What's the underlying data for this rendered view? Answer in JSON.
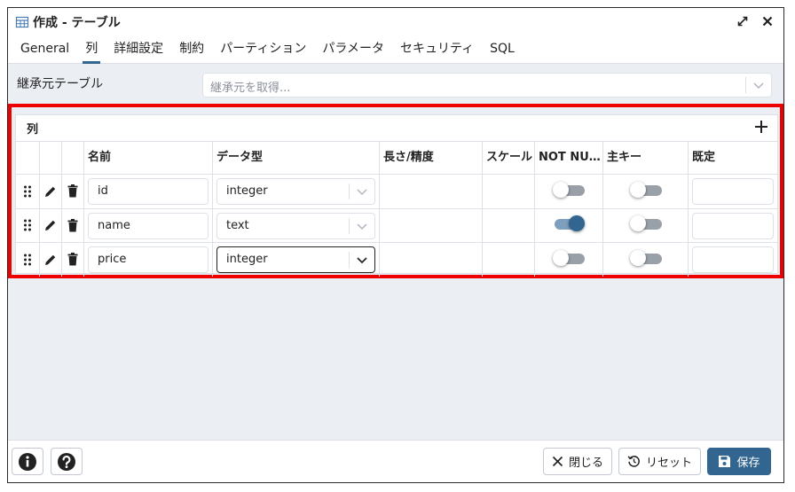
{
  "dialog": {
    "title": "作成 - テーブル",
    "icons": {
      "title": "table-icon",
      "maximize": "maximize-icon",
      "close": "close-icon"
    }
  },
  "tabs": [
    {
      "label": "General",
      "active": false
    },
    {
      "label": "列",
      "active": true
    },
    {
      "label": "詳細設定",
      "active": false
    },
    {
      "label": "制約",
      "active": false
    },
    {
      "label": "パーティション",
      "active": false
    },
    {
      "label": "パラメータ",
      "active": false
    },
    {
      "label": "セキュリティ",
      "active": false
    },
    {
      "label": "SQL",
      "active": false
    }
  ],
  "inherit": {
    "label": "継承元テーブル",
    "placeholder": "継承元を取得..."
  },
  "columns_panel": {
    "title": "列",
    "headers": {
      "name": "名前",
      "type": "データ型",
      "length": "長さ/精度",
      "scale": "スケール",
      "not_null": "NOT NULL",
      "primary_key": "主キー",
      "default": "既定"
    },
    "rows": [
      {
        "name": "id",
        "type": "integer",
        "length": "",
        "scale": "",
        "not_null": false,
        "primary_key": false,
        "default": ""
      },
      {
        "name": "name",
        "type": "text",
        "length": "",
        "scale": "",
        "not_null": true,
        "primary_key": false,
        "default": ""
      },
      {
        "name": "price",
        "type": "integer",
        "length": "",
        "scale": "",
        "not_null": false,
        "primary_key": false,
        "default": ""
      }
    ]
  },
  "footer": {
    "close_label": "閉じる",
    "reset_label": "リセット",
    "save_label": "保存"
  },
  "colors": {
    "accent": "#326690",
    "highlight_border": "#ee0000",
    "toggle_off": "#9aa0a8",
    "dialog_bg": "#ebeef3"
  }
}
